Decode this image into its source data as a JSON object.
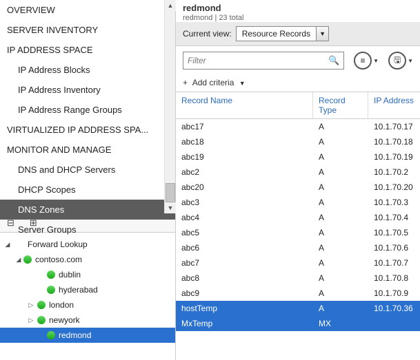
{
  "nav": {
    "items": [
      {
        "label": "OVERVIEW",
        "class": "section"
      },
      {
        "label": "SERVER INVENTORY",
        "class": "section"
      },
      {
        "label": "IP ADDRESS SPACE",
        "class": "section"
      },
      {
        "label": "IP Address Blocks",
        "class": "child"
      },
      {
        "label": "IP Address Inventory",
        "class": "child"
      },
      {
        "label": "IP Address Range Groups",
        "class": "child"
      },
      {
        "label": "VIRTUALIZED IP ADDRESS SPA...",
        "class": "section"
      },
      {
        "label": "MONITOR AND MANAGE",
        "class": "section"
      },
      {
        "label": "DNS and DHCP Servers",
        "class": "child"
      },
      {
        "label": "DHCP Scopes",
        "class": "child"
      },
      {
        "label": "DNS Zones",
        "class": "child",
        "selected": true
      },
      {
        "label": "Server Groups",
        "class": "child"
      }
    ]
  },
  "tree": {
    "root": "Forward Lookup",
    "domain": "contoso.com",
    "nodes": [
      {
        "label": "dublin",
        "expander": "",
        "indent": 64
      },
      {
        "label": "hyderabad",
        "expander": "",
        "indent": 64
      },
      {
        "label": "london",
        "expander": "▷",
        "indent": 50
      },
      {
        "label": "newyork",
        "expander": "▷",
        "indent": 50
      },
      {
        "label": "redmond",
        "expander": "",
        "indent": 64,
        "selected": true
      }
    ]
  },
  "header": {
    "title": "redmond",
    "subtitle": "redmond | 23 total"
  },
  "view": {
    "label": "Current view:",
    "selected": "Resource Records"
  },
  "filter": {
    "placeholder": "Filter"
  },
  "toolbar": {
    "list_glyph": "≡",
    "save_glyph": "🖫"
  },
  "criteria": {
    "plus": "+",
    "label": "Add criteria"
  },
  "grid": {
    "headers": {
      "name": "Record Name",
      "type": "Record Type",
      "ip": "IP Address"
    },
    "rows": [
      {
        "name": "abc17",
        "type": "A",
        "ip": "10.1.70.17"
      },
      {
        "name": "abc18",
        "type": "A",
        "ip": "10.1.70.18"
      },
      {
        "name": "abc19",
        "type": "A",
        "ip": "10.1.70.19"
      },
      {
        "name": "abc2",
        "type": "A",
        "ip": "10.1.70.2"
      },
      {
        "name": "abc20",
        "type": "A",
        "ip": "10.1.70.20"
      },
      {
        "name": "abc3",
        "type": "A",
        "ip": "10.1.70.3"
      },
      {
        "name": "abc4",
        "type": "A",
        "ip": "10.1.70.4"
      },
      {
        "name": "abc5",
        "type": "A",
        "ip": "10.1.70.5"
      },
      {
        "name": "abc6",
        "type": "A",
        "ip": "10.1.70.6"
      },
      {
        "name": "abc7",
        "type": "A",
        "ip": "10.1.70.7"
      },
      {
        "name": "abc8",
        "type": "A",
        "ip": "10.1.70.8"
      },
      {
        "name": "abc9",
        "type": "A",
        "ip": "10.1.70.9"
      },
      {
        "name": "hostTemp",
        "type": "A",
        "ip": "10.1.70.36",
        "selected": true
      },
      {
        "name": "MxTemp",
        "type": "MX",
        "ip": "",
        "selected": true
      }
    ]
  }
}
